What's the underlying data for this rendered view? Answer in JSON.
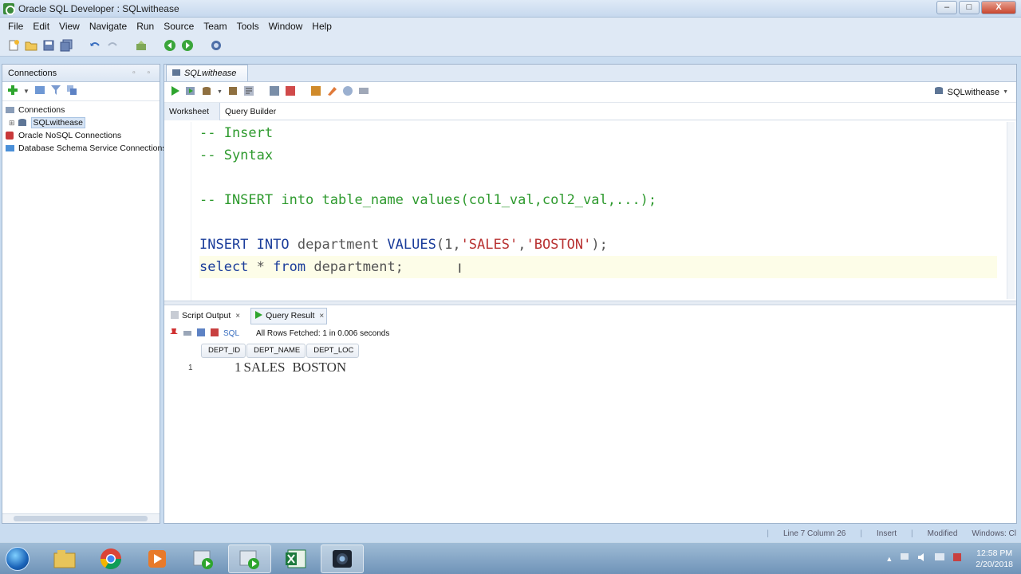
{
  "window": {
    "title": "Oracle SQL Developer : SQLwithease",
    "controls": [
      "–",
      "□",
      "X"
    ]
  },
  "menu": [
    "File",
    "Edit",
    "View",
    "Navigate",
    "Run",
    "Source",
    "Team",
    "Tools",
    "Window",
    "Help"
  ],
  "connections_panel": {
    "title": "Connections",
    "tree": [
      {
        "label": "Connections",
        "icon": "connections-icon"
      },
      {
        "label": "SQLwithease",
        "icon": "database-icon",
        "selected": true
      },
      {
        "label": "Oracle NoSQL Connections",
        "icon": "nosql-icon"
      },
      {
        "label": "Database Schema Service Connections",
        "icon": "cloud-db-icon"
      }
    ]
  },
  "editor": {
    "tab_label": "SQLwithease",
    "connection_selector": "SQLwithease",
    "subtabs": [
      "Worksheet",
      "Query Builder"
    ],
    "lines": [
      {
        "kind": "comment",
        "text": "-- Insert"
      },
      {
        "kind": "comment",
        "text": "-- Syntax"
      },
      {
        "kind": "blank",
        "text": ""
      },
      {
        "kind": "comment",
        "text": "-- INSERT into table_name values(col1_val,col2_val,...);"
      },
      {
        "kind": "blank",
        "text": ""
      },
      {
        "kind": "insert",
        "kw1": "INSERT INTO",
        "t1": " department ",
        "kw2": "VALUES",
        "t2": "(1,",
        "s1": "'SALES'",
        "t3": ",",
        "s2": "'BOSTON'",
        "t4": ");"
      },
      {
        "kind": "select",
        "kw1": "select",
        "t1": " * ",
        "kw2": "from",
        "t2": " department;"
      }
    ]
  },
  "results": {
    "tabs": [
      {
        "label": "Script Output",
        "active": false
      },
      {
        "label": "Query Result",
        "active": true
      }
    ],
    "sql_label": "SQL",
    "status": "All Rows Fetched: 1 in 0.006 seconds",
    "columns": [
      "DEPT_ID",
      "DEPT_NAME",
      "DEPT_LOC"
    ],
    "rows": [
      {
        "num": "1",
        "dept_id": "1",
        "dept_name": "SALES",
        "dept_loc": "BOSTON"
      }
    ]
  },
  "statusbar": {
    "position": "Line 7 Column 26",
    "mode": "Insert",
    "modified": "Modified",
    "os": "Windows: Cl"
  },
  "taskbar": {
    "apps": [
      "explorer-icon",
      "chrome-icon",
      "media-player-icon",
      "sqldev-icon",
      "sqldev-icon-2",
      "excel-icon",
      "camera-icon"
    ],
    "time": "12:58 PM",
    "date": "2/20/2018"
  },
  "colors": {
    "comment": "#2e9a2e",
    "keyword": "#1a3c9a",
    "string": "#b83232",
    "accent": "#c9dcf0"
  }
}
